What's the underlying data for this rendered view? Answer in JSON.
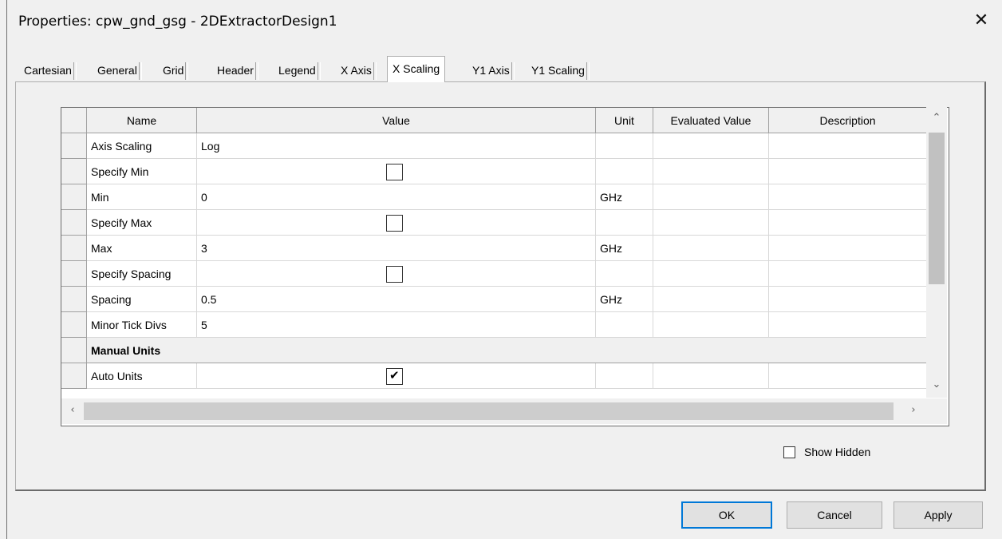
{
  "window": {
    "title": "Properties: cpw_gnd_gsg - 2DExtractorDesign1",
    "close_glyph": "✕"
  },
  "tabs": [
    {
      "label": "Cartesian",
      "active": false
    },
    {
      "label": "General",
      "active": false
    },
    {
      "label": "Grid",
      "active": false
    },
    {
      "label": "Header",
      "active": false
    },
    {
      "label": "Legend",
      "active": false
    },
    {
      "label": "X Axis",
      "active": false
    },
    {
      "label": "X Scaling",
      "active": true
    },
    {
      "label": "Y1 Axis",
      "active": false
    },
    {
      "label": "Y1 Scaling",
      "active": false
    }
  ],
  "grid": {
    "columns": [
      "Name",
      "Value",
      "Unit",
      "Evaluated Value",
      "Description"
    ],
    "rows": [
      {
        "name": "Axis Scaling",
        "value": "Log",
        "unit": "",
        "evaluated": "",
        "description": "",
        "type": "text"
      },
      {
        "name": "Specify Min",
        "value": "",
        "unit": "",
        "evaluated": "",
        "description": "",
        "type": "checkbox",
        "checked": false
      },
      {
        "name": "Min",
        "value": "0",
        "unit": "GHz",
        "evaluated": "",
        "description": "",
        "type": "text"
      },
      {
        "name": "Specify Max",
        "value": "",
        "unit": "",
        "evaluated": "",
        "description": "",
        "type": "checkbox",
        "checked": false
      },
      {
        "name": "Max",
        "value": "3",
        "unit": "GHz",
        "evaluated": "",
        "description": "",
        "type": "text"
      },
      {
        "name": "Specify Spacing",
        "value": "",
        "unit": "",
        "evaluated": "",
        "description": "",
        "type": "checkbox",
        "checked": false
      },
      {
        "name": "Spacing",
        "value": "0.5",
        "unit": "GHz",
        "evaluated": "",
        "description": "",
        "type": "text"
      },
      {
        "name": "Minor Tick Divs",
        "value": "5",
        "unit": "",
        "evaluated": "",
        "description": "",
        "type": "text"
      },
      {
        "section": "Manual Units"
      },
      {
        "name": "Auto Units",
        "value": "",
        "unit": "",
        "evaluated": "",
        "description": "",
        "type": "checkbox",
        "checked": true
      }
    ]
  },
  "options": {
    "show_hidden_label": "Show Hidden",
    "show_hidden_checked": false
  },
  "buttons": {
    "ok": "OK",
    "cancel": "Cancel",
    "apply": "Apply"
  },
  "icons": {
    "scroll_up": "chevron-up-icon",
    "scroll_down": "chevron-down-icon",
    "scroll_left": "chevron-left-icon",
    "scroll_right": "chevron-right-icon"
  },
  "colors": {
    "default_button_border": "#0078d7",
    "dialog_background": "#f0f0f0"
  }
}
